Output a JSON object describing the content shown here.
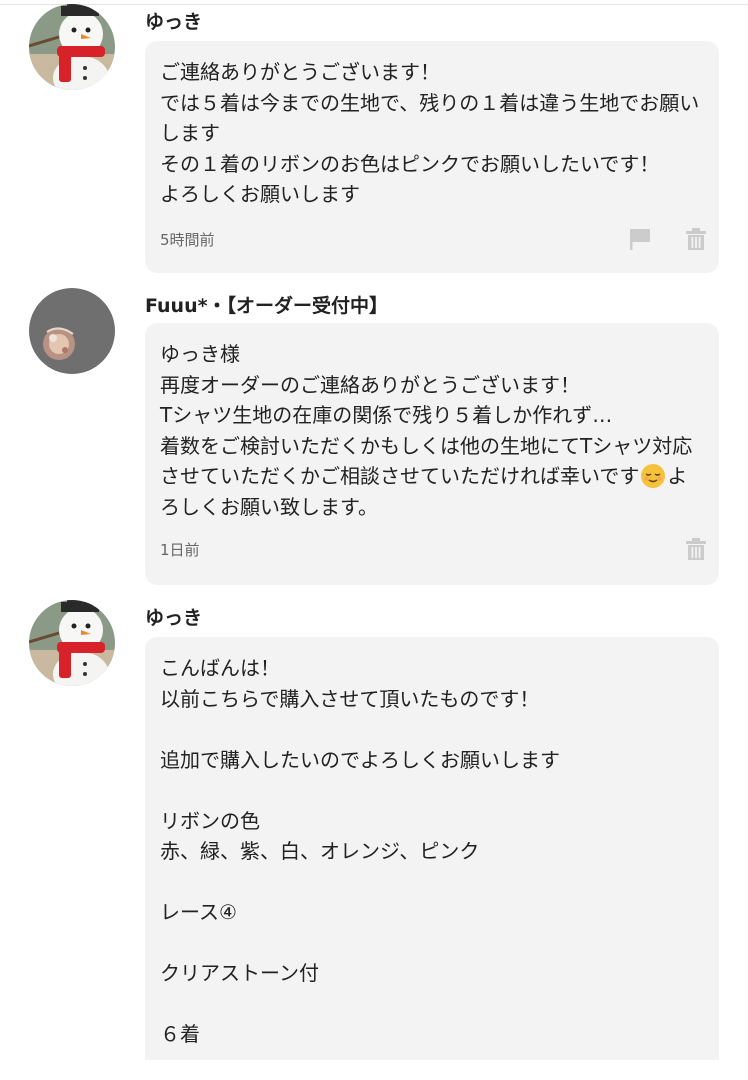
{
  "comments": [
    {
      "username": "ゆっき",
      "avatar_icon": "snowman-avatar-icon",
      "message": "ご連絡ありがとうございます！\nでは５着は今までの生地で、残りの１着は違う生地でお願いします\nその１着のリボンのお色はピンクでお願いしたいです！\nよろしくお願いします",
      "time": "5時間前",
      "has_flag": true
    },
    {
      "username": "Fuuu*・【オーダー受付中】",
      "avatar_icon": "shop-logo-avatar-icon",
      "message_before": "ゆっき様\n再度オーダーのご連絡ありがとうございます！\nTシャツ生地の在庫の関係で残り５着しか作れず…\n着数をご検討いただくかもしくは他の生地にてTシャツ対応させていただくかご相談させていただければ幸いです",
      "emoji": "relieved-face-emoji",
      "message_after": "よろしくお願い致します。",
      "time": "1日前",
      "has_flag": false
    },
    {
      "username": "ゆっき",
      "avatar_icon": "snowman-avatar-icon",
      "message": "こんばんは！\n以前こちらで購入させて頂いたものです！\n\n追加で購入したいのでよろしくお願いします\n\nリボンの色\n赤、緑、紫、白、オレンジ、ピンク\n\nレース④\n\nクリアストーン付\n\n６着"
    }
  ],
  "colors": {
    "bubble_bg": "#f3f3f3",
    "icon_gray": "#cccccc",
    "timestamp": "#666666"
  }
}
